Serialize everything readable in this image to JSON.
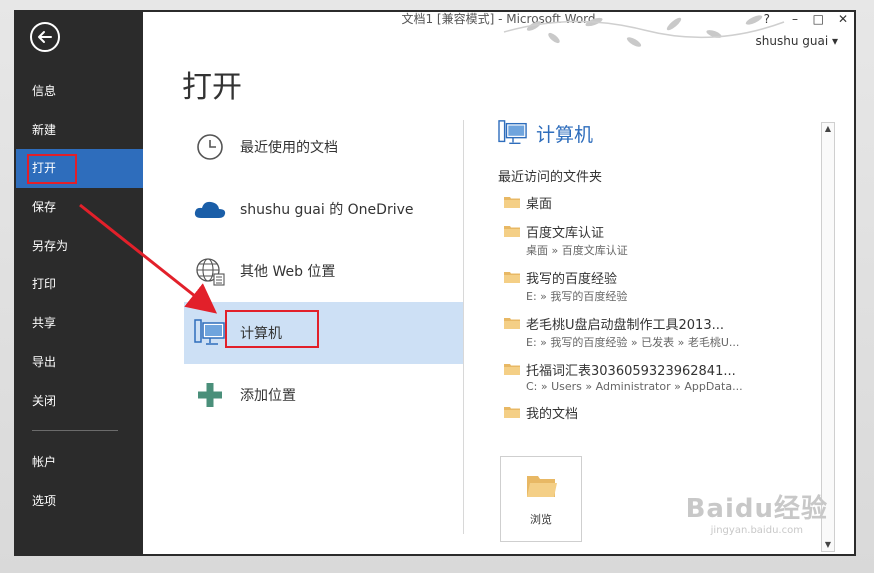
{
  "window": {
    "title": "文档1 [兼容模式] - Microsoft Word",
    "user": "shushu guai ▾",
    "controls": [
      "?",
      "–",
      "□",
      "✕"
    ]
  },
  "sidebar": {
    "items": [
      {
        "label": "信息"
      },
      {
        "label": "新建"
      },
      {
        "label": "打开"
      },
      {
        "label": "保存"
      },
      {
        "label": "另存为"
      },
      {
        "label": "打印"
      },
      {
        "label": "共享"
      },
      {
        "label": "导出"
      },
      {
        "label": "关闭"
      }
    ],
    "bottom_items": [
      {
        "label": "帐户"
      },
      {
        "label": "选项"
      }
    ],
    "active": "打开"
  },
  "main": {
    "title": "打开",
    "places": [
      {
        "label": "最近使用的文档",
        "icon": "clock-icon"
      },
      {
        "label": "shushu guai 的 OneDrive",
        "icon": "cloud-icon"
      },
      {
        "label": "其他 Web 位置",
        "icon": "globe-icon"
      },
      {
        "label": "计算机",
        "icon": "computer-icon",
        "selected": true
      },
      {
        "label": "添加位置",
        "icon": "plus-icon"
      }
    ]
  },
  "right_pane": {
    "title": "计算机",
    "recent_label": "最近访问的文件夹",
    "folders": [
      {
        "name": "桌面",
        "path": ""
      },
      {
        "name": "百度文库认证",
        "path": "桌面 » 百度文库认证"
      },
      {
        "name": "我写的百度经验",
        "path": "E: » 我写的百度经验"
      },
      {
        "name": "老毛桃U盘启动盘制作工具2013...",
        "path": "E: » 我写的百度经验 » 已发表 » 老毛桃U..."
      },
      {
        "name": "托福词汇表3036059323962841...",
        "path": "C: » Users » Administrator » AppData..."
      },
      {
        "name": "我的文档",
        "path": ""
      }
    ],
    "browse_label": "浏览"
  },
  "watermark": {
    "brand": "Baidu经验",
    "url": "jingyan.baidu.com"
  },
  "colors": {
    "sidebar_bg": "#2b2b2b",
    "accent": "#2e6dbc",
    "selection": "#cde0f5",
    "annotation_red": "#e2202a"
  }
}
